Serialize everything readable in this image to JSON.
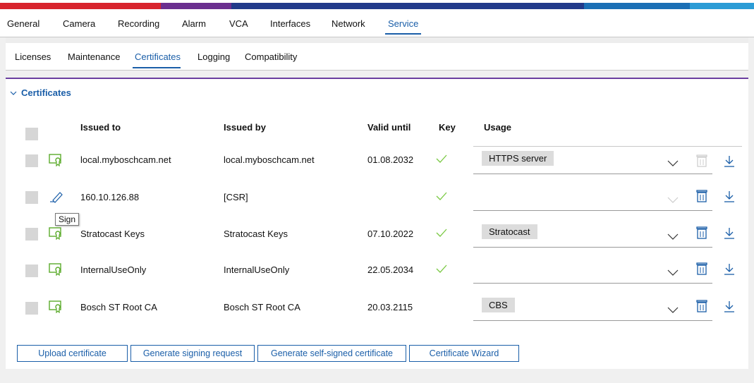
{
  "colors": {
    "accent": "#1a5ea8",
    "check": "#7ac943",
    "section_line": "#6b3fa0"
  },
  "main_tabs": [
    {
      "label": "General"
    },
    {
      "label": "Camera"
    },
    {
      "label": "Recording"
    },
    {
      "label": "Alarm"
    },
    {
      "label": "VCA"
    },
    {
      "label": "Interfaces"
    },
    {
      "label": "Network"
    },
    {
      "label": "Service",
      "active": true
    }
  ],
  "sub_tabs": [
    {
      "label": "Licenses"
    },
    {
      "label": "Maintenance"
    },
    {
      "label": "Certificates",
      "active": true
    },
    {
      "label": "Logging"
    },
    {
      "label": "Compatibility"
    }
  ],
  "section": {
    "title": "Certificates",
    "expanded": true
  },
  "table": {
    "headers": {
      "issued_to": "Issued to",
      "issued_by": "Issued by",
      "valid_until": "Valid until",
      "key": "Key",
      "usage": "Usage"
    },
    "rows": [
      {
        "icon": "certificate-icon",
        "issued_to": "local.myboschcam.net",
        "issued_by": "local.myboschcam.net",
        "valid_until": "01.08.2032",
        "key": true,
        "usage": "HTTPS server"
      },
      {
        "icon": "pencil-icon",
        "issued_to": "160.10.126.88",
        "issued_by": "[CSR]",
        "valid_until": "",
        "key": true,
        "usage": ""
      },
      {
        "icon": "certificate-icon",
        "issued_to": "Stratocast Keys",
        "issued_by": "Stratocast Keys",
        "valid_until": "07.10.2022",
        "key": true,
        "usage": "Stratocast"
      },
      {
        "icon": "certificate-icon",
        "issued_to": "InternalUseOnly",
        "issued_by": "InternalUseOnly",
        "valid_until": "22.05.2034",
        "key": true,
        "usage": ""
      },
      {
        "icon": "certificate-icon",
        "issued_to": "Bosch ST Root CA",
        "issued_by": "Bosch ST Root CA",
        "valid_until": "20.03.2115",
        "key": false,
        "usage": "CBS"
      }
    ]
  },
  "tooltip": "Sign",
  "buttons": {
    "upload": "Upload certificate",
    "signing_request": "Generate signing request",
    "self_signed": "Generate self-signed certificate",
    "wizard": "Certificate Wizard"
  }
}
